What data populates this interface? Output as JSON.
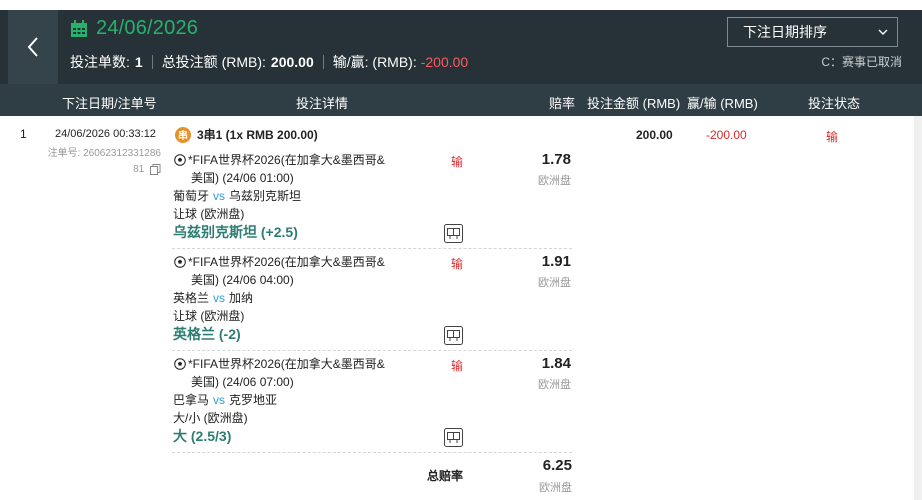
{
  "header": {
    "date": "24/06/2026",
    "summary": {
      "count_label": "投注单数:",
      "count_value": "1",
      "stake_label": "总投注额 (RMB):",
      "stake_value": "200.00",
      "winloss_label": "输/赢: (RMB):",
      "winloss_value": "-200.00"
    },
    "sort": {
      "selected": "下注日期排序"
    },
    "note": "C：赛事已取消"
  },
  "columns": {
    "date_order": "下注日期/注单号",
    "details": "投注详情",
    "odds": "赔率",
    "stake": "投注金额 (RMB)",
    "winloss": "赢/输 (RMB)",
    "status": "投注状态"
  },
  "bet": {
    "index": "1",
    "datetime": "24/06/2026 00:33:12",
    "order_label": "注单号:",
    "order_no_line1": "26062312331286",
    "order_no_line2": "81",
    "combo_badge": "串",
    "combo": "3串1 (1x RMB 200.00)",
    "stake": "200.00",
    "winloss": "-200.00",
    "status": "输",
    "legs": [
      {
        "event_line1": "*FIFA世界杯2026(在加拿大&墨西哥&",
        "event_line2": "美国) (24/06 01:00)",
        "home": "葡萄牙",
        "vs": "vs",
        "away": "乌兹别克斯坦",
        "market": "让球 (欧洲盘)",
        "selection": "乌兹别克斯坦 (+2.5)",
        "result": "输",
        "odds": "1.78",
        "odds_type": "欧洲盘"
      },
      {
        "event_line1": "*FIFA世界杯2026(在加拿大&墨西哥&",
        "event_line2": "美国) (24/06 04:00)",
        "home": "英格兰",
        "vs": "vs",
        "away": "加纳",
        "market": "让球 (欧洲盘)",
        "selection": "英格兰 (-2)",
        "result": "输",
        "odds": "1.91",
        "odds_type": "欧洲盘"
      },
      {
        "event_line1": "*FIFA世界杯2026(在加拿大&墨西哥&",
        "event_line2": "美国) (24/06 07:00)",
        "home": "巴拿马",
        "vs": "vs",
        "away": "克罗地亚",
        "market": "大/小 (欧洲盘)",
        "selection": "大 (2.5/3)",
        "result": "输",
        "odds": "1.84",
        "odds_type": "欧洲盘"
      }
    ],
    "total_odds_label": "总赔率",
    "total_odds": "6.25",
    "total_odds_type": "欧洲盘"
  },
  "colors": {
    "header_bg": "#263238",
    "accent_green": "#27b26b",
    "loss_red": "#d92b2b",
    "selection_teal": "#2e7d74",
    "vs_blue": "#2a9fd6"
  }
}
